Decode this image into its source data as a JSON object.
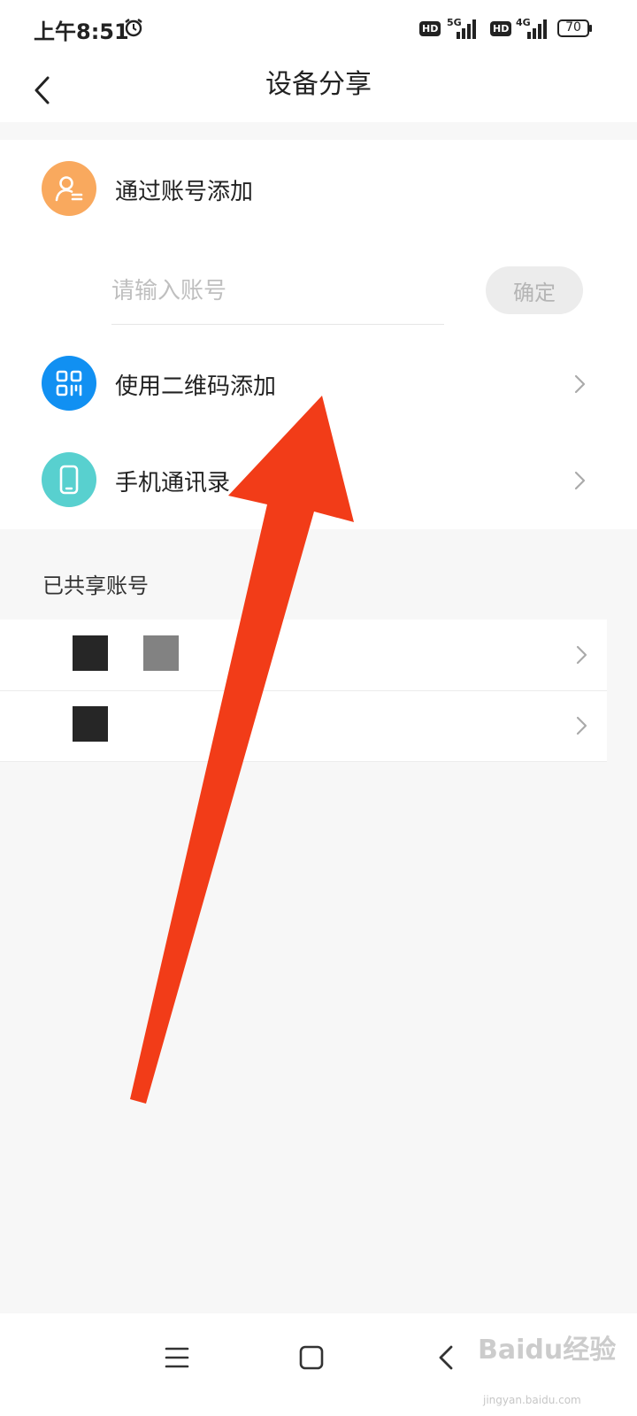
{
  "status_bar": {
    "time": "上午8:51",
    "network_1": "5G",
    "network_2": "4G",
    "hd_label": "HD",
    "battery": "70"
  },
  "header": {
    "title": "设备分享"
  },
  "add_by_account": {
    "label": "通过账号添加",
    "input_placeholder": "请输入账号",
    "input_value": "",
    "confirm_label": "确定"
  },
  "add_by_qr": {
    "label": "使用二维码添加"
  },
  "add_by_contacts": {
    "label": "手机通讯录"
  },
  "shared": {
    "title": "已共享账号"
  },
  "watermark": {
    "brand": "Baidu经验",
    "url": "jingyan.baidu.com"
  },
  "colors": {
    "account_icon": "#f9a95e",
    "qr_icon": "#1190f2",
    "contacts_icon": "#58d0cf",
    "arrow": "#f23c18"
  }
}
